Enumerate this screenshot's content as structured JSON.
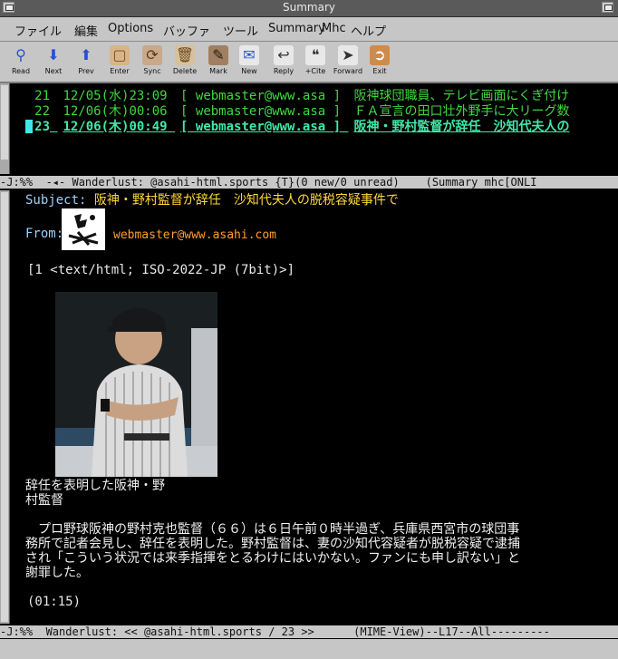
{
  "window": {
    "title": "Summary"
  },
  "menu": [
    "ファイル",
    "編集",
    "Options",
    "バッファ",
    "ツール",
    "Summary",
    "Mhc",
    "ヘルプ"
  ],
  "toolbar": [
    {
      "label": "Read",
      "icon": "magnifier-icon"
    },
    {
      "label": "Next",
      "icon": "arrow-down-icon"
    },
    {
      "label": "Prev",
      "icon": "arrow-up-icon"
    },
    {
      "label": "Enter",
      "icon": "open-folder-icon"
    },
    {
      "label": "Sync",
      "icon": "sync-icon"
    },
    {
      "label": "Delete",
      "icon": "trash-icon"
    },
    {
      "label": "Mark",
      "icon": "mark-icon"
    },
    {
      "label": "New",
      "icon": "new-mail-icon"
    },
    {
      "label": "Reply",
      "icon": "reply-icon"
    },
    {
      "label": "+Cite",
      "icon": "cite-icon"
    },
    {
      "label": "Forward",
      "icon": "forward-icon"
    },
    {
      "label": "Exit",
      "icon": "exit-icon"
    }
  ],
  "summary": {
    "rows": [
      {
        "num": "21",
        "date": "12/05(水)23:09",
        "from": "[ webmaster@www.asa ]",
        "subject": "阪神球団職員、テレビ画面にくぎ付け"
      },
      {
        "num": "22",
        "date": "12/06(木)00:06",
        "from": "[ webmaster@www.asa ]",
        "subject": "ＦＡ宣言の田口壮外野手に大リーグ数"
      },
      {
        "num": "23",
        "date": "12/06(木)00:49",
        "from": "[ webmaster@www.asa ]",
        "subject": "阪神・野村監督が辞任　沙知代夫人の"
      }
    ]
  },
  "modeline_summary": "-J:%%  -◂- Wanderlust: @asahi-html.sports {T}(0 new/0 unread)    (Summary mhc[ONLI",
  "message": {
    "subject_label": "Subject:",
    "subject": "阪神・野村監督が辞任　沙知代夫人の脱税容疑事件で",
    "from_label": "From:",
    "from": "webmaster@www.asahi.com",
    "mime": "[1  <text/html; ISO-2022-JP (7bit)>]",
    "caption_line1": "辞任を表明した阪神・野",
    "caption_line2": "村監督",
    "body_lines": [
      "　プロ野球阪神の野村克也監督（６６）は６日午前０時半過ぎ、兵庫県西宮市の球団事",
      "務所で記者会見し、辞任を表明した。野村監督は、妻の沙知代容疑者が脱税容疑で逮捕",
      "され「こういう状況では来季指揮をとるわけにはいかない。ファンにも申し訳ない」と",
      "謝罪した。"
    ],
    "time": "(01:15)"
  },
  "modeline_message": "-J:%%  Wanderlust: << @asahi-html.sports / 23 >>      (MIME-View)--L17--All---------"
}
